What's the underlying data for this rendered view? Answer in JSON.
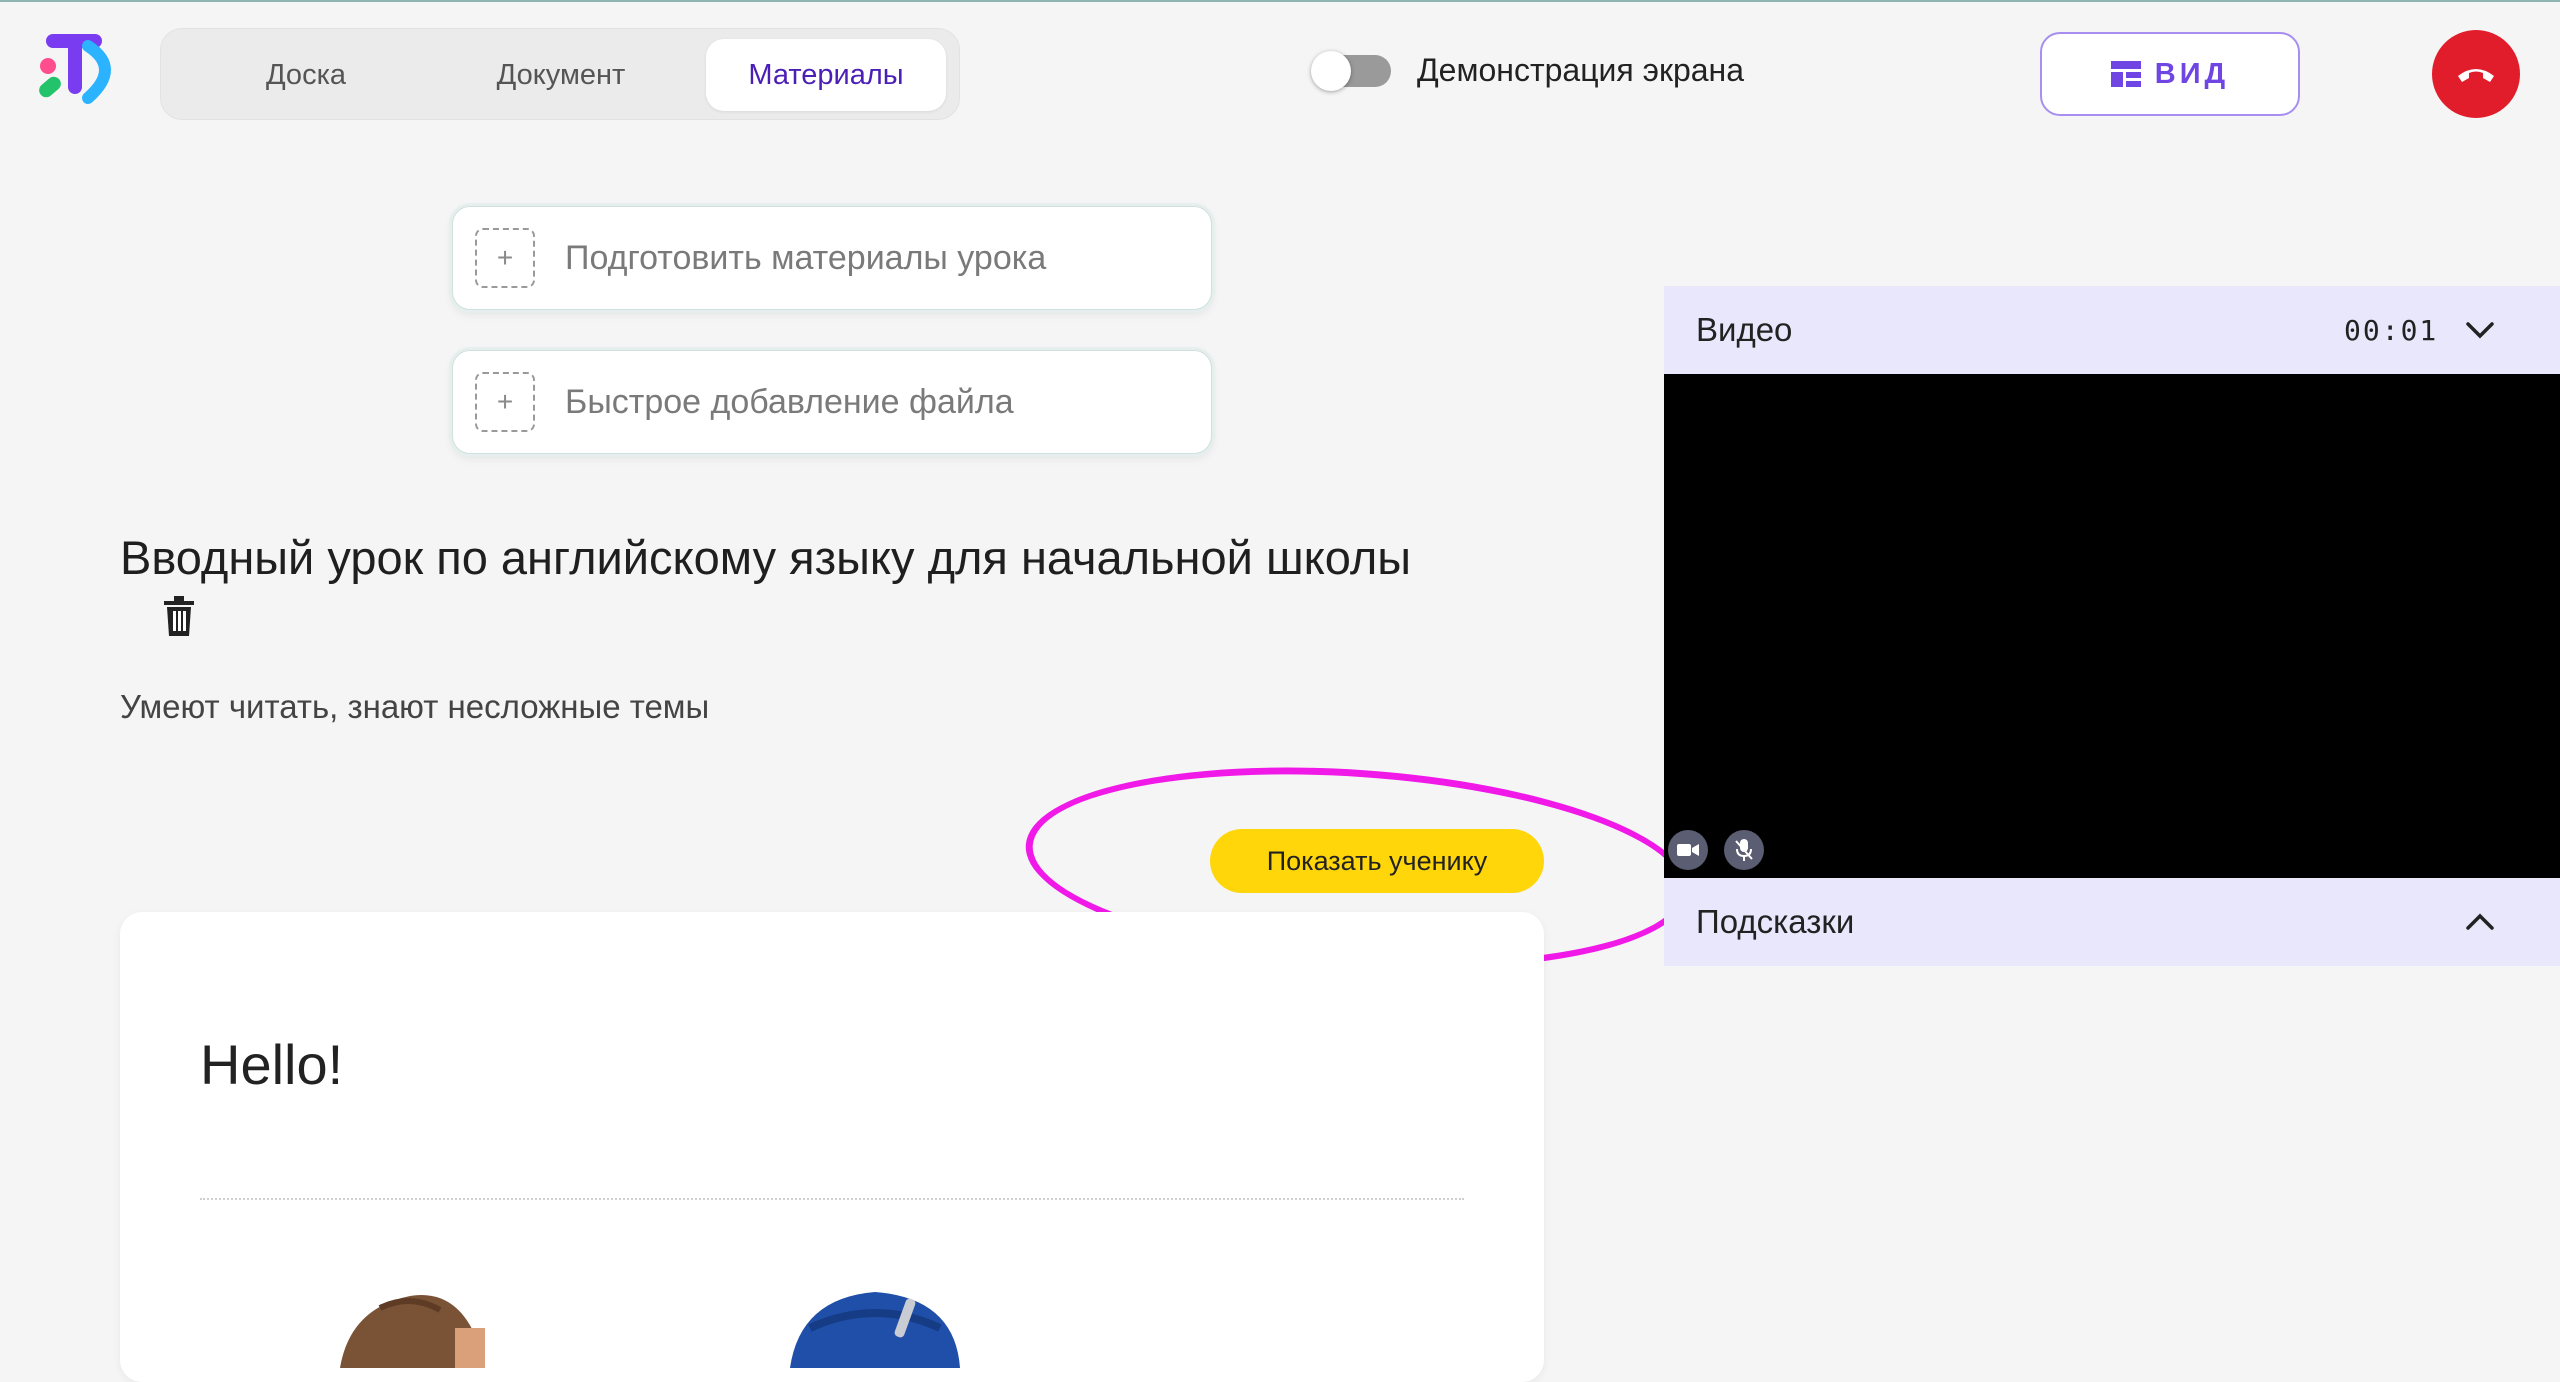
{
  "header": {
    "tabs": [
      {
        "label": "Доска",
        "active": false
      },
      {
        "label": "Документ",
        "active": false
      },
      {
        "label": "Материалы",
        "active": true
      }
    ],
    "screen_share": {
      "label": "Демонстрация экрана",
      "enabled": false
    },
    "view_button": {
      "label": "ВИД",
      "icon": "layout-icon"
    },
    "end_call": {
      "icon": "phone-hangup-icon",
      "color": "#e11d2c"
    }
  },
  "actions": [
    {
      "label": "Подготовить материалы урока",
      "icon": "add-box-icon"
    },
    {
      "label": "Быстрое добавление файла",
      "icon": "add-box-icon"
    }
  ],
  "lesson": {
    "title": "Вводный урок по английскому языку для начальной школы",
    "description": "Умеют читать, знают несложные темы",
    "show_button": "Показать ученику",
    "card_heading": "Hello!"
  },
  "side_panel": {
    "video": {
      "title": "Видео",
      "timer": "00:01",
      "expanded": true
    },
    "hints": {
      "title": "Подсказки",
      "expanded": false
    }
  },
  "colors": {
    "accent": "#4b1fb5",
    "view_button": "#6f45e3",
    "show_button": "#ffd60a",
    "highlight": "#f019e8",
    "panel_header": "#e8e7fb"
  }
}
